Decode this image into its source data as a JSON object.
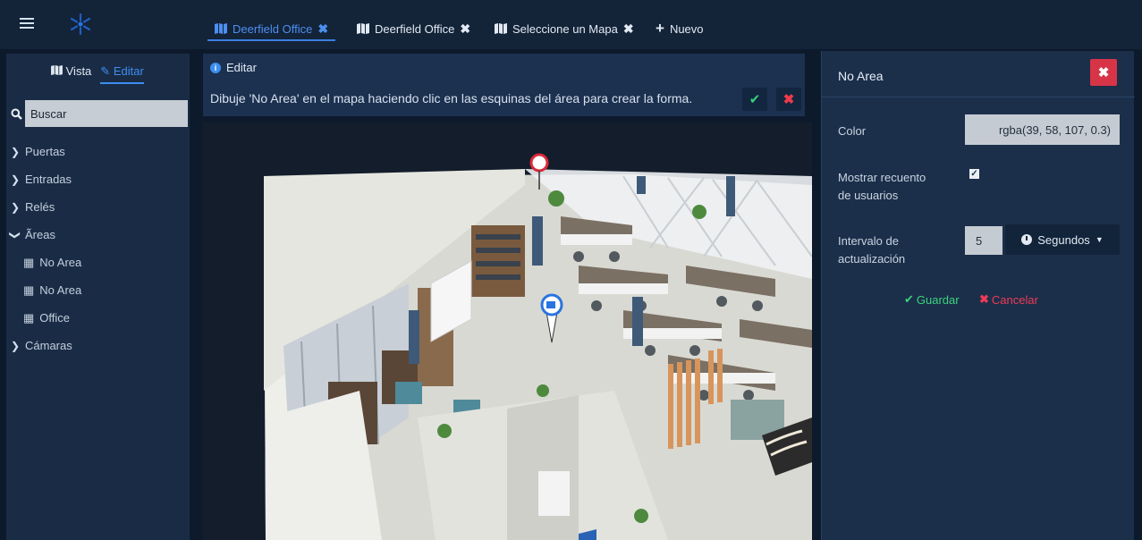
{
  "topbar": {
    "tabs": [
      {
        "label": "Deerfield Office",
        "active": true
      },
      {
        "label": "Deerfield Office",
        "active": false
      },
      {
        "label": "Seleccione un Mapa",
        "active": false
      }
    ],
    "new_label": "Nuevo"
  },
  "sidebar": {
    "view_label": "Vista",
    "edit_label": "Editar",
    "search_placeholder": "Buscar",
    "tree": [
      {
        "label": "Puertas",
        "expanded": false
      },
      {
        "label": "Entradas",
        "expanded": false
      },
      {
        "label": "Relés",
        "expanded": false
      },
      {
        "label": "Ãreas",
        "expanded": true
      },
      {
        "label": "No Area",
        "child": true
      },
      {
        "label": "No Area",
        "child": true
      },
      {
        "label": "Office",
        "child": true
      },
      {
        "label": "Cámaras",
        "expanded": false
      }
    ]
  },
  "edit_panel": {
    "title": "Editar",
    "instruction": "Dibuje 'No Area' en el mapa haciendo clic en las esquinas del área para crear la forma."
  },
  "properties": {
    "title": "No Area",
    "color_label": "Color",
    "color_value": "rgba(39, 58, 107, 0.3)",
    "show_count_label_1": "Mostrar recuento",
    "show_count_label_2": "de usuarios",
    "show_count_checked": true,
    "interval_label_1": "Intervalo de",
    "interval_label_2": "actualización",
    "interval_value": "5",
    "interval_unit": "Segundos",
    "save_label": "Guardar",
    "cancel_label": "Cancelar"
  },
  "colors": {
    "accent": "#3d8ef0",
    "success": "#3bd37c",
    "danger": "#e23a50",
    "background": "#0d1a2c",
    "panel": "#1b2f4a"
  }
}
